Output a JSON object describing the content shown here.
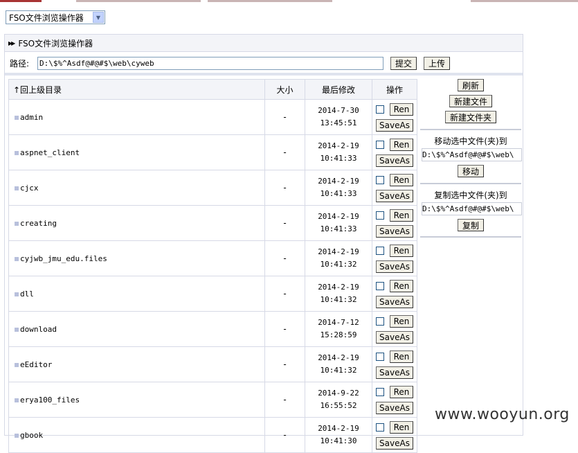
{
  "mode_select": {
    "value": "FSO文件浏览操作器"
  },
  "panel": {
    "title": "FSO文件浏览操作器"
  },
  "path_bar": {
    "label": "路径:",
    "value": "D:\\$%^Asdf@#@#$\\web\\cyweb",
    "submit_label": "提交",
    "upload_label": "上传"
  },
  "table": {
    "headers": {
      "name": "↑回上级目录",
      "size": "大小",
      "modified": "最后修改",
      "ops": "操作"
    },
    "rows": [
      {
        "name": "admin",
        "size": "-",
        "date": "2014-7-30",
        "time": "13:45:51"
      },
      {
        "name": "aspnet_client",
        "size": "-",
        "date": "2014-2-19",
        "time": "10:41:33"
      },
      {
        "name": "cjcx",
        "size": "-",
        "date": "2014-2-19",
        "time": "10:41:33"
      },
      {
        "name": "creating",
        "size": "-",
        "date": "2014-2-19",
        "time": "10:41:33"
      },
      {
        "name": "cyjwb_jmu_edu.files",
        "size": "-",
        "date": "2014-2-19",
        "time": "10:41:32"
      },
      {
        "name": "dll",
        "size": "-",
        "date": "2014-2-19",
        "time": "10:41:32"
      },
      {
        "name": "download",
        "size": "-",
        "date": "2014-7-12",
        "time": "15:28:59"
      },
      {
        "name": "eEditor",
        "size": "-",
        "date": "2014-2-19",
        "time": "10:41:32"
      },
      {
        "name": "erya100_files",
        "size": "-",
        "date": "2014-9-22",
        "time": "16:55:52"
      },
      {
        "name": "gbook",
        "size": "-",
        "date": "2014-2-19",
        "time": "10:41:30"
      }
    ],
    "rename_label": "Ren",
    "saveas_label": "SaveAs"
  },
  "right_panel": {
    "refresh_label": "刷新",
    "new_file_label": "新建文件",
    "new_folder_label": "新建文件夹",
    "move_caption": "移动选中文件(夹)到",
    "move_path": "D:\\$%^Asdf@#@#$\\web\\",
    "move_label": "移动",
    "copy_caption": "复制选中文件(夹)到",
    "copy_path": "D:\\$%^Asdf@#@#$\\web\\",
    "copy_label": "复制"
  },
  "watermark": "www.wooyun.org",
  "colors": {
    "accent_strip": "#a83434",
    "header_bg": "#f3f4f8",
    "border": "#d6d9e6",
    "button_bg": "#f2f0e6"
  }
}
